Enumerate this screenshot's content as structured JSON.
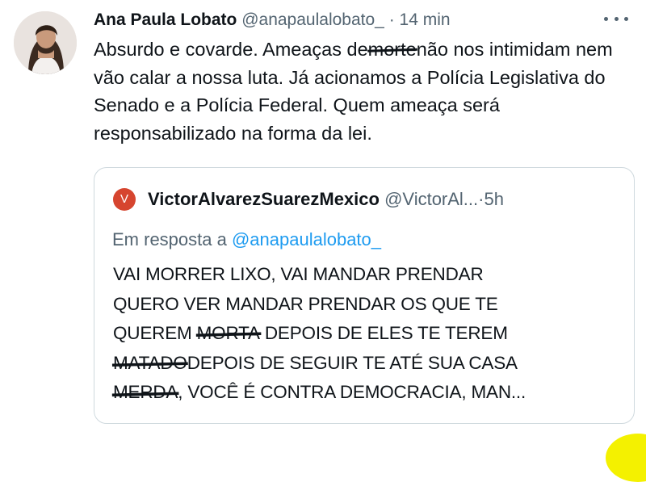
{
  "tweet": {
    "author_name": "Ana Paula Lobato",
    "handle": "@anapaulalobato_",
    "separator": "·",
    "time": "14 min",
    "text_part1": "Absurdo e covarde. Ameaças de",
    "struck_word": "morte",
    "text_part2": "não nos intimidam nem vão calar a nossa luta. Já acionamos a Polícia Legislativa do Senado e a Polícia Federal. Quem ameaça será responsabilizado na forma da lei."
  },
  "quoted_tweet": {
    "avatar_letter": "V",
    "author_name": "VictorAlvarezSuarezMexico",
    "handle": "@VictorAl...",
    "separator": "·",
    "time": "5h",
    "reply_prefix": "Em resposta a",
    "reply_to": "@anapaulalobato_",
    "line1": "VAI MORRER LIXO, VAI MANDAR PRENDAR",
    "line2": "QUERO VER MANDAR PRENDAR OS QUE TE",
    "line3_a": "QUEREM",
    "line3_struck": "MORTA",
    "line3_b": "DEPOIS DE ELES TE TEREM",
    "line4_struck": "MATADO",
    "line4_b": "DEPOIS DE SEGUIR TE ATÉ SUA CASA",
    "line5_struck": "MERDA",
    "line5_b": ", VOCÊ É CONTRA DEMOCRACIA, MAN..."
  },
  "icons": {
    "more": "more-horizontal-icon",
    "avatar": "profile-photo",
    "quoted_avatar_color": "#d6452f",
    "mention_color": "#1d9bf0"
  }
}
